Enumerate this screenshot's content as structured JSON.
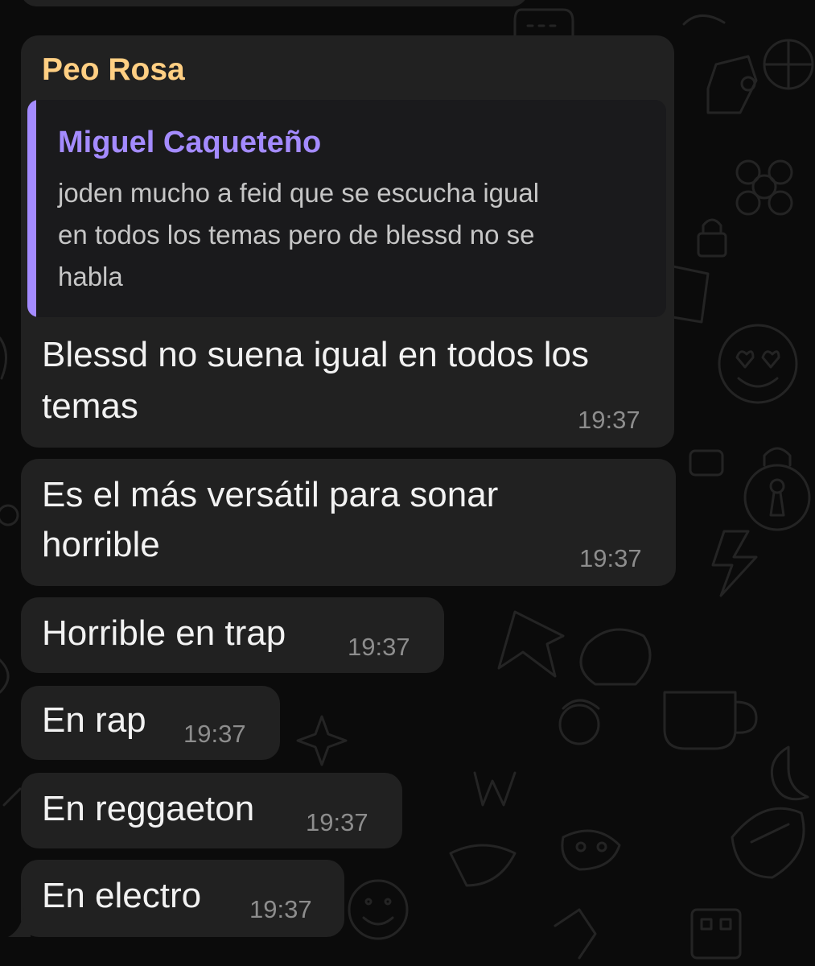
{
  "chat": {
    "sender_name": "Peo Rosa",
    "reply": {
      "author": "Miguel Caqueteño",
      "lines": [
        "joden mucho a feid que se escucha igual",
        "en todos los temas pero de blessd no se",
        "habla"
      ]
    },
    "messages": [
      {
        "lines": [
          "Blessd no suena igual en todos los",
          "temas"
        ],
        "time": "19:37"
      },
      {
        "lines": [
          "Es el más versátil para sonar",
          "horrible"
        ],
        "time": "19:37"
      },
      {
        "lines": [
          "Horrible en trap"
        ],
        "time": "19:37"
      },
      {
        "lines": [
          "En rap"
        ],
        "time": "19:37"
      },
      {
        "lines": [
          "En reggaeton"
        ],
        "time": "19:37"
      },
      {
        "lines": [
          "En electro"
        ],
        "time": "19:37"
      }
    ]
  },
  "colors": {
    "background": "#0b0b0b",
    "bubble": "#212121",
    "sender_name": "#ffcf83",
    "reply_accent": "#a48bff",
    "message_text": "#f2f2f2",
    "time_text": "#8d8d8d"
  },
  "icons": [
    "balloon-icon",
    "lock-icon",
    "heart-face-icon",
    "star-icon",
    "flower-icon",
    "cup-icon",
    "pin-icon",
    "bolt-icon",
    "moon-icon",
    "smiley-icon",
    "football-icon"
  ]
}
